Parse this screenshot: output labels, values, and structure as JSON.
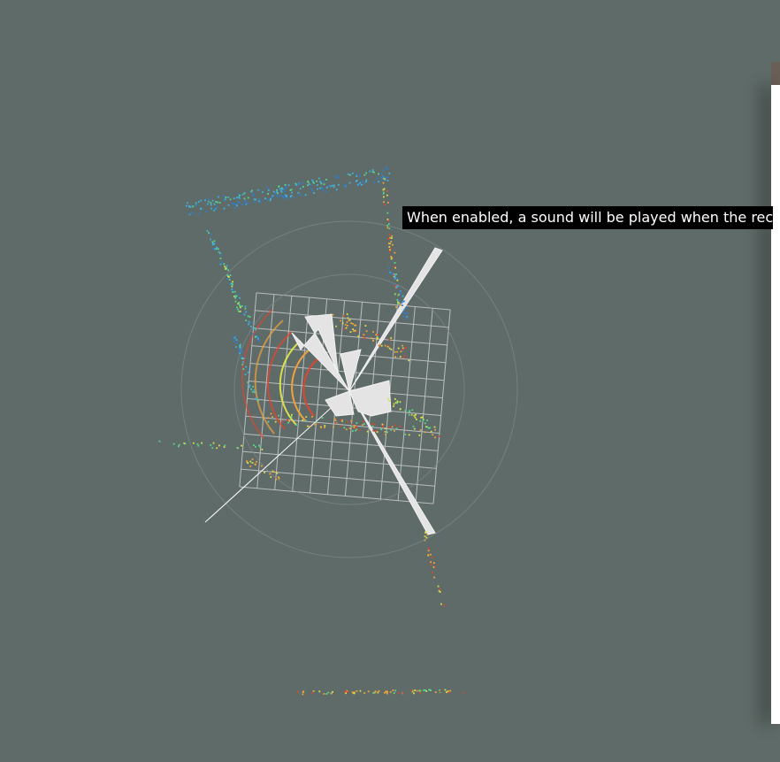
{
  "tooltip": {
    "text": "When enabled, a sound will be played when the rec"
  },
  "viewport": {
    "background_color": "#5f6b68",
    "grid_color": "#c9cccc",
    "scan_fill_color": "#e4e4e4",
    "point_colors": [
      "#2c7fd6",
      "#3fb3e0",
      "#58d68d",
      "#d9e04a",
      "#f0a33a",
      "#e0452f"
    ]
  },
  "side_panel": {
    "background_color": "#ffffff"
  }
}
